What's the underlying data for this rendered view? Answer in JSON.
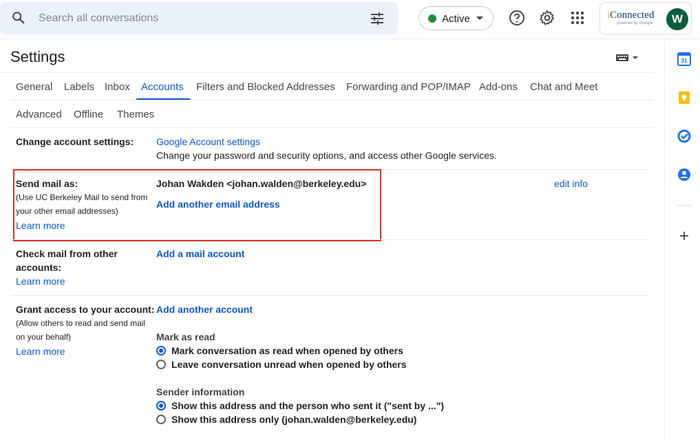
{
  "search": {
    "placeholder": "Search all conversations"
  },
  "status": {
    "label": "Active",
    "color": "#1e8e3e"
  },
  "account": {
    "logo_text": "Connected",
    "logo_prefix": "i",
    "logo_sub": "powered by Google",
    "avatar_letter": "W"
  },
  "settings": {
    "title": "Settings"
  },
  "tabs": {
    "row1": [
      "General",
      "Labels",
      "Inbox",
      "Accounts",
      "Filters and Blocked Addresses",
      "Forwarding and POP/IMAP",
      "Add-ons",
      "Chat and Meet"
    ],
    "row2": [
      "Advanced",
      "Offline",
      "Themes"
    ],
    "active": "Accounts"
  },
  "sections": {
    "change_account": {
      "label": "Change account settings:",
      "link": "Google Account settings",
      "desc": "Change your password and security options, and access other Google services."
    },
    "send_mail": {
      "label": "Send mail as:",
      "note_line1": "(Use UC Berkeley Mail to send from",
      "note_line2": "your other email addresses)",
      "learn_more": "Learn more",
      "address": "Johan Wakden <johan.walden@berkeley.edu>",
      "edit": "edit info",
      "add_link": "Add another email address"
    },
    "check_mail": {
      "label_line1": "Check mail from other",
      "label_line2": "accounts:",
      "learn_more": "Learn more",
      "add_link": "Add a mail account"
    },
    "grant_access": {
      "label": "Grant access to your account:",
      "note_line1": "(Allow others to read and send mail",
      "note_line2": "on your behalf)",
      "learn_more": "Learn more",
      "add_link": "Add another account",
      "mark_as_read_title": "Mark as read",
      "mark_as_read_options": [
        "Mark conversation as read when opened by others",
        "Leave conversation unread when opened by others"
      ],
      "sender_info_title": "Sender information",
      "sender_info_options": [
        "Show this address and the person who sent it (\"sent by ...\")",
        "Show this address only (johan.walden@berkeley.edu)"
      ]
    }
  },
  "side_panel": {
    "calendar_day": "31"
  },
  "colors": {
    "accent": "#0b57d0",
    "highlight": "#d93025",
    "search_bg": "#eaf1fb"
  }
}
